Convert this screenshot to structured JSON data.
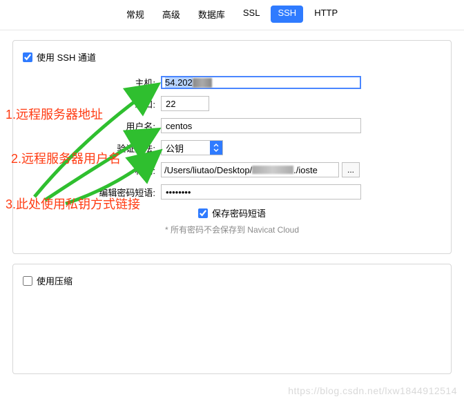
{
  "tabs": {
    "general": "常规",
    "advanced": "高级",
    "database": "数据库",
    "ssl": "SSL",
    "ssh": "SSH",
    "http": "HTTP"
  },
  "ssh": {
    "use_tunnel_label": "使用 SSH 通道",
    "use_tunnel_checked": true,
    "host_label": "主机:",
    "host_value": "54.202",
    "port_label": "端口:",
    "port_value": "22",
    "user_label": "用户名:",
    "user_value": "centos",
    "auth_label": "验证方法:",
    "auth_value": "公钥",
    "key_label": "私钥:",
    "key_value": "/Users/liutao/Desktop/                           ./ioste",
    "browse_label": "...",
    "pass_label": "编辑密码短语:",
    "pass_value": "••••••••",
    "save_pass_label": "保存密码短语",
    "save_pass_checked": true,
    "note": "* 所有密码不会保存到 Navicat Cloud"
  },
  "compress": {
    "use_compress_label": "使用压缩",
    "checked": false
  },
  "annotations": {
    "a1": "1.远程服务器地址",
    "a2": "2.远程服务器用户名",
    "a3": "3.此处使用私钥方式链接"
  },
  "watermark": "https://blog.csdn.net/lxw1844912514"
}
